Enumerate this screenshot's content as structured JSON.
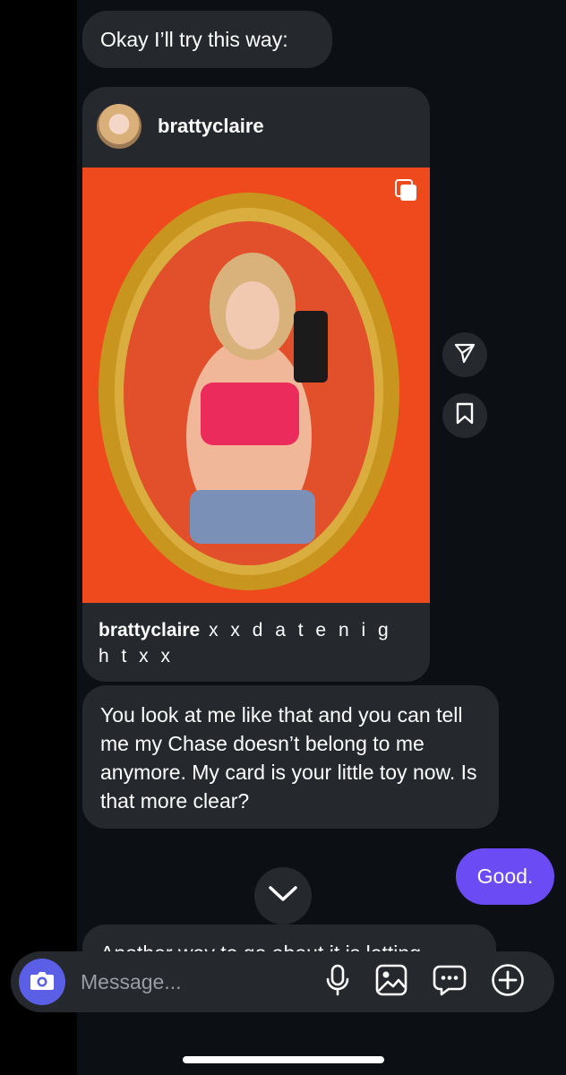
{
  "messages": {
    "msg1": "Okay I’ll try this way:",
    "msg2": "You look at me like that and you can tell me my Chase doesn’t belong to me anymore. My card is your little toy now. Is that more clear?",
    "sent": "Good.",
    "msg3": "Another way to go about it is letting"
  },
  "post": {
    "username": "brattyclaire",
    "caption_user": "brattyclaire",
    "caption_text": " x x  d a t e  n i g h t  x x"
  },
  "composer": {
    "placeholder": "Message..."
  },
  "icons": {
    "camera": "camera-icon",
    "mic": "microphone-icon",
    "gallery": "gallery-icon",
    "sticker": "sticker-icon",
    "plus": "plus-icon",
    "share": "send-icon",
    "save": "bookmark-icon",
    "scroll": "chevron-down-icon",
    "multi": "carousel-icon"
  },
  "colors": {
    "accent": "#6b4bf3",
    "camera": "#5a5fe6",
    "bubble": "#25282d",
    "background": "#0c0f14"
  }
}
